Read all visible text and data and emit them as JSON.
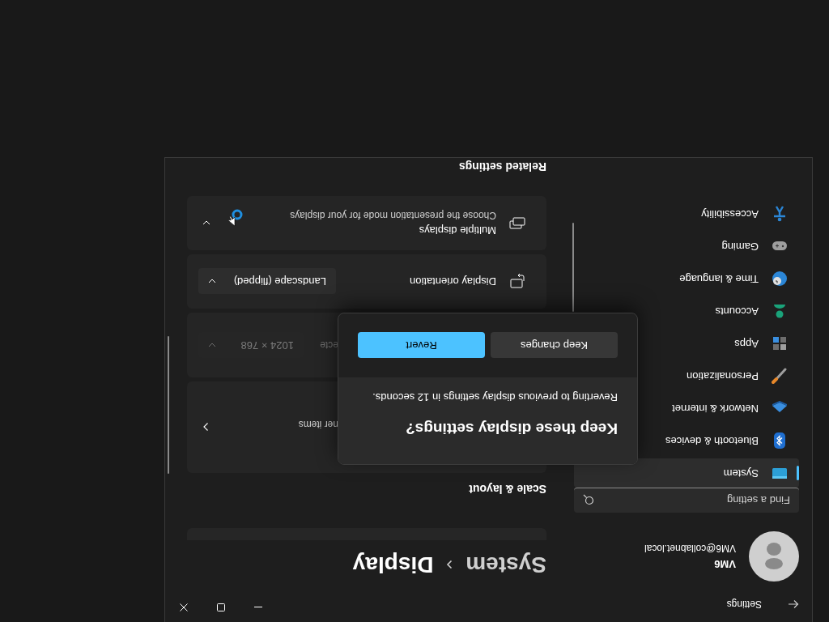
{
  "window": {
    "title": "Settings"
  },
  "user": {
    "name": "VM6",
    "email": "VM6@collabnet.local"
  },
  "search": {
    "placeholder": "Find a setting"
  },
  "nav": {
    "items": [
      {
        "label": "System",
        "selected": true
      },
      {
        "label": "Bluetooth & devices",
        "selected": false
      },
      {
        "label": "Network & internet",
        "selected": false
      },
      {
        "label": "Personalization",
        "selected": false
      },
      {
        "label": "Apps",
        "selected": false
      },
      {
        "label": "Accounts",
        "selected": false
      },
      {
        "label": "Time & language",
        "selected": false
      },
      {
        "label": "Gaming",
        "selected": false
      },
      {
        "label": "Accessibility",
        "selected": false
      }
    ]
  },
  "breadcrumb": [
    "System",
    "Display"
  ],
  "section": "Scale & layout",
  "cards": [
    {
      "kind": "link",
      "subtitle": "ner items"
    },
    {
      "kind": "dropdown",
      "subtitle": "ecte",
      "value": "1024 × 768",
      "disabled": true
    },
    {
      "kind": "dropdown",
      "title": "Display orientation",
      "value": "Landscape (flipped)",
      "disabled": false
    },
    {
      "kind": "expander",
      "title": "Multiple displays",
      "subtitle": "Choose the presentation mode for your displays",
      "expanded": false
    }
  ],
  "related": "Related settings",
  "dialog": {
    "title": "Keep these display settings?",
    "message": "Reverting to previous display settings in 12 seconds.",
    "buttons": [
      {
        "label": "Keep changes",
        "kind": "secondary"
      },
      {
        "label": "Revert",
        "kind": "primary"
      }
    ]
  }
}
